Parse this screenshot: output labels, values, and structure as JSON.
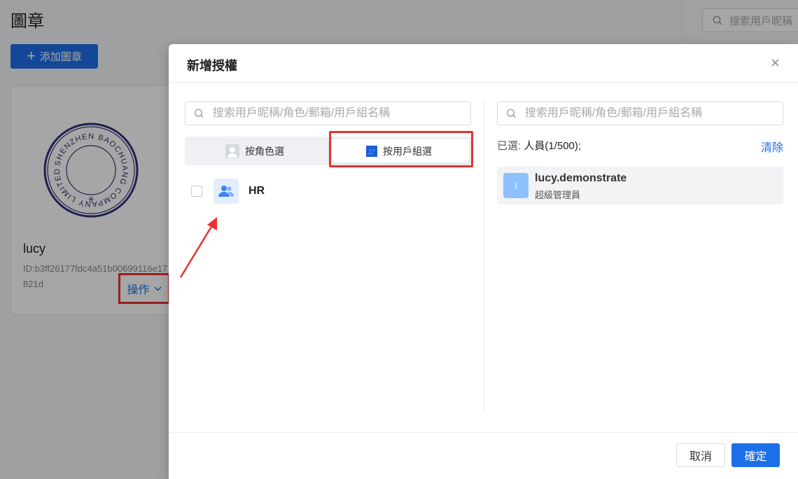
{
  "background": {
    "page_title": "圖章",
    "add_button_label": "添加圖章",
    "card": {
      "seal_text": "SHENZHEN BAOCHUANG COMPANY LIMITED",
      "name": "lucy",
      "id_text": "ID:b3ff26177fdc4a51b00699116e17821d",
      "action_label": "操作"
    },
    "search_placeholder": "搜索用戶昵稱"
  },
  "modal": {
    "title": "新增授權",
    "left": {
      "search_placeholder": "搜索用戶昵稱/角色/郵箱/用戶組名稱",
      "tabs": [
        {
          "label": "按角色選"
        },
        {
          "label": "按用戶組選"
        }
      ],
      "groups": [
        {
          "name": "HR"
        }
      ]
    },
    "right": {
      "search_placeholder": "搜索用戶昵稱/角色/郵箱/用戶組名稱",
      "selected_prefix": "已選:",
      "selected_text": "人員(1/500);",
      "clear_label": "清除",
      "selected_items": [
        {
          "avatar_letter": "l",
          "name": "lucy.demonstrate",
          "role": "超級管理員"
        }
      ]
    },
    "footer": {
      "cancel_label": "取消",
      "confirm_label": "確定"
    }
  },
  "colors": {
    "primary": "#1d6fe8",
    "highlight": "#e8322e"
  }
}
